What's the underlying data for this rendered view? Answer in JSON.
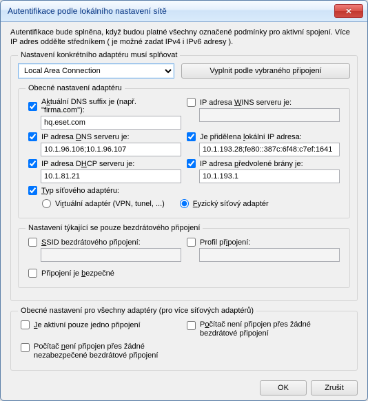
{
  "window": {
    "title": "Autentifikace podle lokálního nastavení sítě"
  },
  "intro": "Autentifikace bude splněna, když budou platné všechny označené podmínky pro aktivní spojení. Více IP adres oddělte středníkem ( je možné zadat IPv4 i IPv6 adresy ).",
  "adapter_section_legend": "Nastavení konkrétního adaptéru musí splňovat",
  "connection_options": [
    "Local Area Connection"
  ],
  "connection_selected": "Local Area Connection",
  "fill_button": "Vyplnit podle vybraného připojení",
  "general_adapter_legend": "Obecné nastavení adaptéru",
  "dns_suffix": {
    "prefix": "A",
    "uline": "k",
    "suffix": "tuální DNS suffix je (např. \"firma.com\"):",
    "checked": true,
    "value": "hq.eset.com"
  },
  "wins_ip": {
    "prefix": "IP adresa ",
    "uline": "W",
    "suffix": "INS serveru je:",
    "checked": false,
    "value": ""
  },
  "dns_ip": {
    "prefix": "IP adresa ",
    "uline": "D",
    "suffix": "NS serveru je:",
    "checked": true,
    "value": "10.1.96.106;10.1.96.107"
  },
  "local_ip": {
    "prefix": "Je přidělena ",
    "uline": "l",
    "suffix": "okální IP adresa:",
    "checked": true,
    "value": "10.1.193.28;fe80::387c:6f48:c7ef:1641"
  },
  "dhcp_ip": {
    "prefix": "IP adresa D",
    "uline": "H",
    "suffix": "CP serveru je:",
    "checked": true,
    "value": "10.1.81.21"
  },
  "gateway_ip": {
    "prefix": "IP adresa ",
    "uline": "p",
    "suffix": "ředvolené brány je:",
    "checked": true,
    "value": "10.1.193.1"
  },
  "adapter_type": {
    "prefix": "",
    "uline": "T",
    "suffix": "yp síťového adaptéru:",
    "checked": true
  },
  "radio_virtual": {
    "prefix": "Vi",
    "uline": "r",
    "suffix": "tuální adaptér (VPN, tunel, ...)"
  },
  "radio_physical": {
    "prefix": "",
    "uline": "F",
    "suffix": "yzický síťový adaptér"
  },
  "radio_selected": "physical",
  "wireless_legend": "Nastavení týkající se pouze bezdrátového připojení",
  "ssid": {
    "prefix": "",
    "uline": "S",
    "suffix": "SID bezdrátového připojení:",
    "checked": false,
    "value": ""
  },
  "profile": {
    "prefix": "Profil př",
    "uline": "i",
    "suffix": "pojení:",
    "checked": false,
    "value": ""
  },
  "secure_conn": {
    "prefix": "Připojení je ",
    "uline": "b",
    "suffix": "ezpečné",
    "checked": false
  },
  "all_adapters_legend": "Obecné nastavení pro všechny adaptéry (pro více síťových adaptérů)",
  "one_active": {
    "prefix": "",
    "uline": "J",
    "suffix": "e aktivní pouze jedno připojení",
    "checked": false
  },
  "no_wireless": {
    "prefix": "P",
    "uline": "o",
    "suffix": "čítač není připojen přes žádné bezdrátové připojení",
    "checked": false
  },
  "no_unsecured_wireless": {
    "prefix": "Počítač ",
    "uline": "n",
    "suffix": "ení připojen přes žádné nezabezpečené bezdrátové připojení",
    "checked": false
  },
  "buttons": {
    "ok": "OK",
    "cancel": "Zrušit"
  }
}
